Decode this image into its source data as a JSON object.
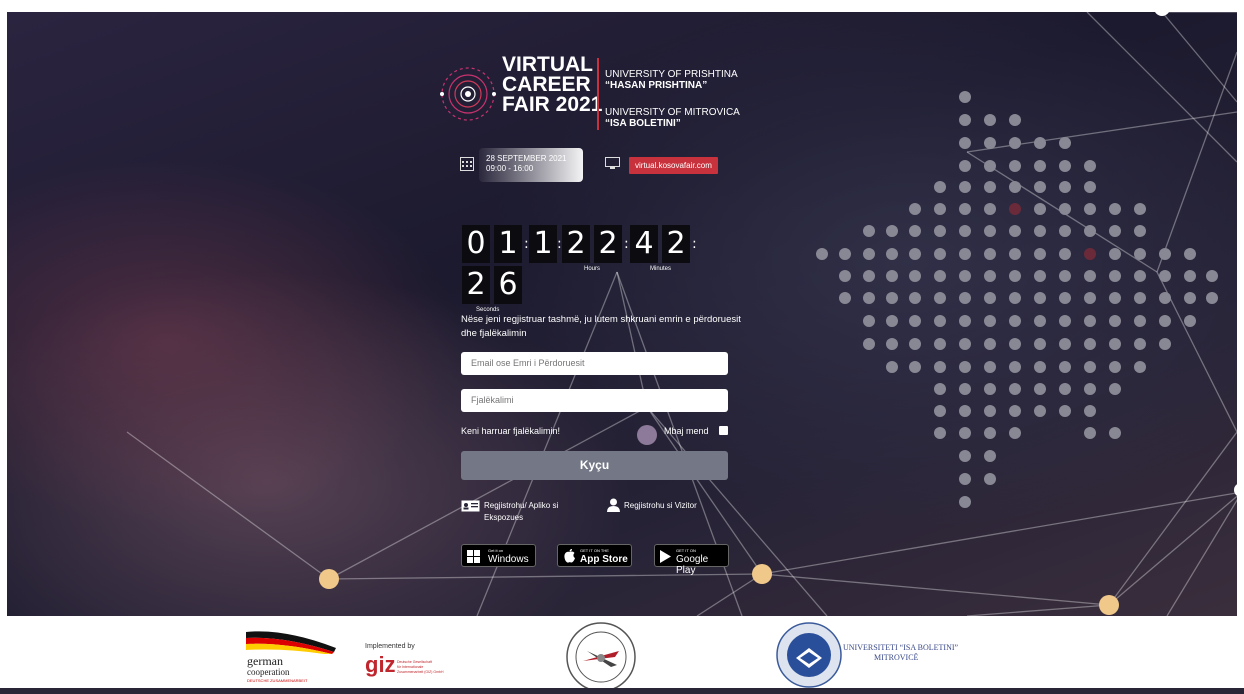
{
  "event": {
    "title_lines": [
      "VIRTUAL",
      "CAREER",
      "FAIR 2021"
    ],
    "university_1_line1": "UNIVERSITY OF PRISHTINA",
    "university_1_line2": "“HASAN PRISHTINA”",
    "university_2_line1": "UNIVERSITY OF MITROVICA",
    "university_2_line2": "“ISA BOLETINI”",
    "date": "28 SEPTEMBER 2021",
    "time": "09:00 - 16:00",
    "url": "virtual.kosovafair.com"
  },
  "countdown": {
    "digits": [
      "0",
      "1",
      "1",
      "2",
      "2",
      "4",
      "2",
      "2",
      "6"
    ],
    "labels": {
      "hours": "Hours",
      "minutes": "Minutes",
      "seconds": "Seconds"
    }
  },
  "login": {
    "info": "Nëse jeni regjistruar tashmë, ju lutem shkruani emrin e përdoruesit dhe fjalëkalimin",
    "email_placeholder": "Email ose Emri i Përdoruesit",
    "password_placeholder": "Fjalëkalimi",
    "forgot_password": "Keni harruar fjalëkalimin!",
    "remember_me": "Mbaj mend",
    "submit_label": "Kyçu",
    "register_exhibitor": "Regjistrohu/ Apliko si Ekspozues",
    "register_visitor": "Regjistrohu si Vizitor"
  },
  "stores": [
    {
      "small": "Get it on",
      "big": "Windows",
      "icon": "windows-icon"
    },
    {
      "small": "GET IT ON THE",
      "big": "App Store",
      "icon": "apple-icon"
    },
    {
      "small": "GET IT ON",
      "big": "Google Play",
      "icon": "google-play-icon"
    }
  ],
  "footer": {
    "german_line1": "german",
    "german_line2": "cooperation",
    "german_line3": "DEUTSCHE ZUSAMMENARBEIT",
    "implemented_by": "Implemented by",
    "giz": "giz",
    "giz_note_1": "Deutsche Gesellschaft",
    "giz_note_2": "für Internationale",
    "giz_note_3": "Zusammenarbeit (GIZ) GmbH",
    "isa_line1": "UNIVERSITETI “ISA BOLETINI”",
    "isa_line2": "MITROVICË"
  },
  "colors": {
    "accent": "#c8323c",
    "button": "#737786",
    "node": "#f0c88a"
  }
}
